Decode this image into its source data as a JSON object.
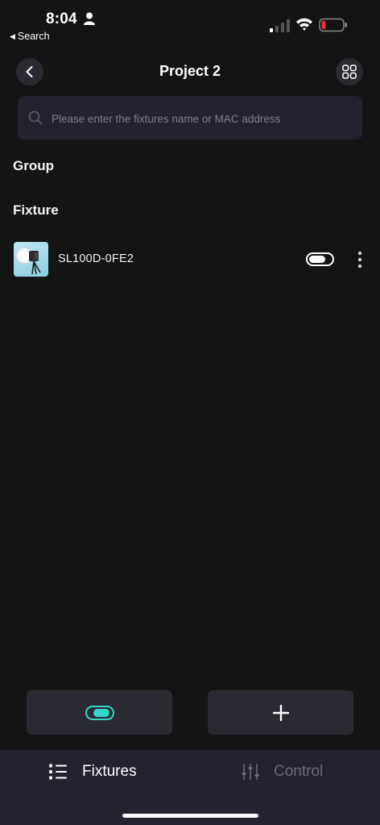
{
  "status_bar": {
    "time": "8:04",
    "back_app": "Search",
    "icons": [
      "person-icon",
      "signal-icon",
      "wifi-icon",
      "battery-icon"
    ],
    "battery_color": "#e5322d"
  },
  "header": {
    "title": "Project 2",
    "back_icon": "chevron-left-icon",
    "layout_icon": "grid-icon"
  },
  "search": {
    "placeholder": "Please enter the fixtures name or MAC address",
    "value": ""
  },
  "sections": {
    "group_title": "Group",
    "fixture_title": "Fixture"
  },
  "fixtures": [
    {
      "name": "SL100D-0FE2",
      "power_on": true
    }
  ],
  "bottom_actions": {
    "power_all_icon": "toggle-icon",
    "add_icon": "plus-icon",
    "accent_color": "#33d6c8"
  },
  "tab_bar": {
    "tabs": [
      {
        "label": "Fixtures",
        "icon": "list-icon",
        "active": true
      },
      {
        "label": "Control",
        "icon": "sliders-icon",
        "active": false
      }
    ]
  }
}
